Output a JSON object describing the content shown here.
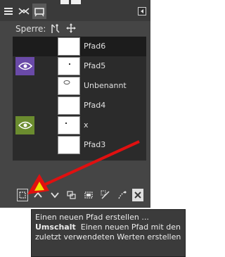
{
  "lock": {
    "label": "Sperre:"
  },
  "paths": [
    {
      "name": "Pfad6",
      "visible": false,
      "selected": true
    },
    {
      "name": "Pfad5",
      "visible": true,
      "eye_color": "#6a4aa8"
    },
    {
      "name": "Unbenannt",
      "visible": false
    },
    {
      "name": "Pfad4",
      "visible": false
    },
    {
      "name": "x",
      "visible": true,
      "eye_color": "#6b8c2f"
    },
    {
      "name": "Pfad3",
      "visible": false
    }
  ],
  "tooltip": {
    "line1": "Einen neuen Pfad erstellen ...",
    "modifier": "Umschalt",
    "line2_rest": "Einen neuen Pfad mit den zuletzt verwendeten Werten erstellen"
  },
  "colors": {
    "annotation_arrow": "#e01010",
    "annotation_arrow_head": "#f0e000"
  },
  "icons": {
    "tabs": [
      "layers-icon",
      "channels-icon",
      "paths-icon"
    ],
    "lock": [
      "lock-position-icon",
      "lock-move-icon"
    ],
    "toolbar": [
      "new-path-icon",
      "raise-icon",
      "lower-icon",
      "duplicate-icon",
      "path-to-selection-icon",
      "selection-to-path-icon",
      "paint-along-path-icon",
      "delete-icon"
    ]
  }
}
